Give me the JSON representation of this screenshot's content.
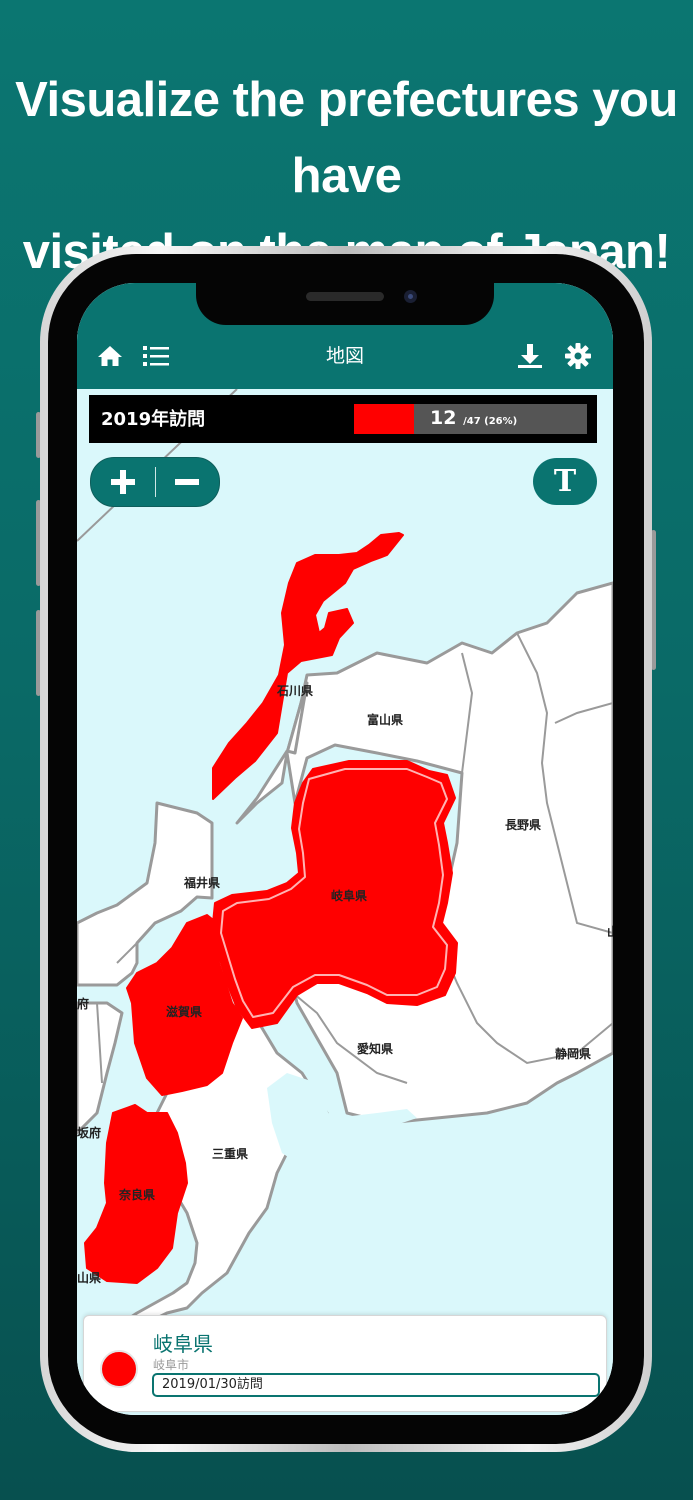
{
  "headline": {
    "line1": "Visualize the prefectures you have",
    "line2": "visited on the map of Japan!"
  },
  "app": {
    "title": "地図",
    "icons": {
      "home": "home-icon",
      "list": "list-icon",
      "download": "download-icon",
      "settings": "gear-icon"
    }
  },
  "status": {
    "label": "2019年訪問",
    "visited": "12",
    "total_text": "/47 (26%)",
    "progress_fraction": 0.26
  },
  "zoom": {
    "in_icon": "plus-icon",
    "out_icon": "minus-icon",
    "text_toggle": "T"
  },
  "map": {
    "labels": {
      "ishikawa": "石川県",
      "toyama": "富山県",
      "nagano": "長野県",
      "fukui": "福井県",
      "gifu": "岐阜県",
      "shiga": "滋賀県",
      "aichi": "愛知県",
      "shizuoka": "静岡県",
      "mie": "三重県",
      "nara": "奈良県",
      "fu_partial": "府",
      "osaka_partial": "坂府",
      "wakayama_partial": "山県",
      "yamanashi_partial": "山"
    },
    "visited_color": "#ff0000",
    "unvisited_color": "#ffffff",
    "sea_color": "#daf8fb"
  },
  "card": {
    "name": "岐阜県",
    "city": "岐阜市",
    "visit": "2019/01/30訪問",
    "dot_color": "#ff0000"
  },
  "colors": {
    "brand": "#0a7470",
    "background": "#0b7671"
  }
}
